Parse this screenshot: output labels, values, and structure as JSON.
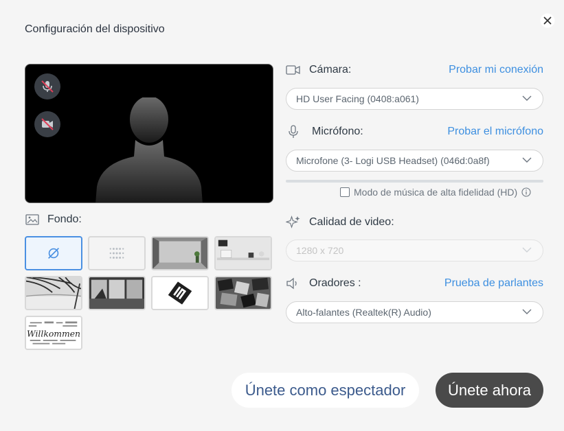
{
  "dialog": {
    "title": "Configuración del dispositivo",
    "close_icon": "close-icon"
  },
  "preview": {
    "mic_state": "muted",
    "camera_state": "off",
    "placeholder": "person-silhouette"
  },
  "background": {
    "label": "Fondo:",
    "selected_index": 0,
    "options": [
      {
        "kind": "none",
        "icon": "no-background-icon"
      },
      {
        "kind": "blur",
        "icon": "blur-icon"
      },
      {
        "kind": "image",
        "scene": "empty-room"
      },
      {
        "kind": "image",
        "scene": "white-office"
      },
      {
        "kind": "image",
        "scene": "palm-beach"
      },
      {
        "kind": "image",
        "scene": "window-view"
      },
      {
        "kind": "image",
        "scene": "logo"
      },
      {
        "kind": "image",
        "scene": "photo-collage"
      },
      {
        "kind": "image",
        "scene": "willkommen-words"
      }
    ]
  },
  "camera": {
    "label": "Cámara:",
    "test_link": "Probar mi conexión",
    "selected": "HD User Facing (0408:a061)"
  },
  "microphone": {
    "label": "Micrófono:",
    "test_link": "Probar el micrófono",
    "selected": "Microfone (3- Logi USB Headset) (046d:0a8f)",
    "level": 0
  },
  "hd_music": {
    "label": "Modo de música de alta fidelidad (HD)",
    "checked": false
  },
  "video_quality": {
    "label": "Calidad de video:",
    "selected": "1280 x 720",
    "disabled": true
  },
  "speakers": {
    "label": "Oradores :",
    "test_link": "Prueba de parlantes",
    "selected": "Alto-falantes (Realtek(R) Audio)"
  },
  "actions": {
    "spectator": "Únete como espectador",
    "join": "Únete ahora"
  },
  "colors": {
    "accent_link": "#3d8fe0",
    "join_button": "#4a4a4a",
    "mute_slash": "#e0405a"
  }
}
